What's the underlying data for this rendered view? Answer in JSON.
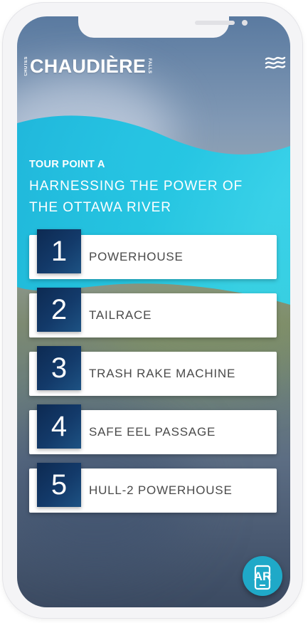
{
  "brand": {
    "name": "CHAUDIÈRE",
    "left_tag": "CHUTES",
    "right_tag": "FALLS"
  },
  "menu": {
    "icon": "menu-waves-icon"
  },
  "tour": {
    "point_label": "TOUR POINT A",
    "title": "HARNESSING THE POWER OF THE OTTAWA RIVER"
  },
  "stops": [
    {
      "number": "1",
      "label": "POWERHOUSE"
    },
    {
      "number": "2",
      "label": "TAILRACE"
    },
    {
      "number": "3",
      "label": "TRASH RAKE MACHINE"
    },
    {
      "number": "4",
      "label": "SAFE EEL PASSAGE"
    },
    {
      "number": "5",
      "label": "HULL-2 POWERHOUSE"
    }
  ],
  "ar_button": {
    "label": "AR",
    "icon": "phone-ar-icon"
  },
  "colors": {
    "accent_cyan": "#1fc3e3",
    "number_tile_navy": "#133a6a",
    "ar_button": "#1fa9c8"
  }
}
